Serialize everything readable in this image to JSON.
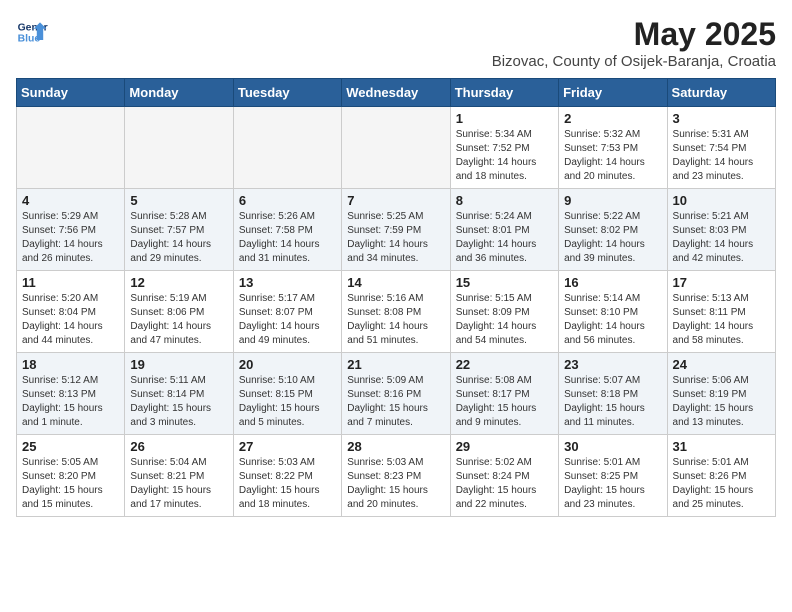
{
  "logo": {
    "line1": "General",
    "line2": "Blue"
  },
  "title": {
    "month_year": "May 2025",
    "location": "Bizovac, County of Osijek-Baranja, Croatia"
  },
  "weekdays": [
    "Sunday",
    "Monday",
    "Tuesday",
    "Wednesday",
    "Thursday",
    "Friday",
    "Saturday"
  ],
  "weeks": [
    [
      {
        "day": "",
        "info": ""
      },
      {
        "day": "",
        "info": ""
      },
      {
        "day": "",
        "info": ""
      },
      {
        "day": "",
        "info": ""
      },
      {
        "day": "1",
        "info": "Sunrise: 5:34 AM\nSunset: 7:52 PM\nDaylight: 14 hours\nand 18 minutes."
      },
      {
        "day": "2",
        "info": "Sunrise: 5:32 AM\nSunset: 7:53 PM\nDaylight: 14 hours\nand 20 minutes."
      },
      {
        "day": "3",
        "info": "Sunrise: 5:31 AM\nSunset: 7:54 PM\nDaylight: 14 hours\nand 23 minutes."
      }
    ],
    [
      {
        "day": "4",
        "info": "Sunrise: 5:29 AM\nSunset: 7:56 PM\nDaylight: 14 hours\nand 26 minutes."
      },
      {
        "day": "5",
        "info": "Sunrise: 5:28 AM\nSunset: 7:57 PM\nDaylight: 14 hours\nand 29 minutes."
      },
      {
        "day": "6",
        "info": "Sunrise: 5:26 AM\nSunset: 7:58 PM\nDaylight: 14 hours\nand 31 minutes."
      },
      {
        "day": "7",
        "info": "Sunrise: 5:25 AM\nSunset: 7:59 PM\nDaylight: 14 hours\nand 34 minutes."
      },
      {
        "day": "8",
        "info": "Sunrise: 5:24 AM\nSunset: 8:01 PM\nDaylight: 14 hours\nand 36 minutes."
      },
      {
        "day": "9",
        "info": "Sunrise: 5:22 AM\nSunset: 8:02 PM\nDaylight: 14 hours\nand 39 minutes."
      },
      {
        "day": "10",
        "info": "Sunrise: 5:21 AM\nSunset: 8:03 PM\nDaylight: 14 hours\nand 42 minutes."
      }
    ],
    [
      {
        "day": "11",
        "info": "Sunrise: 5:20 AM\nSunset: 8:04 PM\nDaylight: 14 hours\nand 44 minutes."
      },
      {
        "day": "12",
        "info": "Sunrise: 5:19 AM\nSunset: 8:06 PM\nDaylight: 14 hours\nand 47 minutes."
      },
      {
        "day": "13",
        "info": "Sunrise: 5:17 AM\nSunset: 8:07 PM\nDaylight: 14 hours\nand 49 minutes."
      },
      {
        "day": "14",
        "info": "Sunrise: 5:16 AM\nSunset: 8:08 PM\nDaylight: 14 hours\nand 51 minutes."
      },
      {
        "day": "15",
        "info": "Sunrise: 5:15 AM\nSunset: 8:09 PM\nDaylight: 14 hours\nand 54 minutes."
      },
      {
        "day": "16",
        "info": "Sunrise: 5:14 AM\nSunset: 8:10 PM\nDaylight: 14 hours\nand 56 minutes."
      },
      {
        "day": "17",
        "info": "Sunrise: 5:13 AM\nSunset: 8:11 PM\nDaylight: 14 hours\nand 58 minutes."
      }
    ],
    [
      {
        "day": "18",
        "info": "Sunrise: 5:12 AM\nSunset: 8:13 PM\nDaylight: 15 hours\nand 1 minute."
      },
      {
        "day": "19",
        "info": "Sunrise: 5:11 AM\nSunset: 8:14 PM\nDaylight: 15 hours\nand 3 minutes."
      },
      {
        "day": "20",
        "info": "Sunrise: 5:10 AM\nSunset: 8:15 PM\nDaylight: 15 hours\nand 5 minutes."
      },
      {
        "day": "21",
        "info": "Sunrise: 5:09 AM\nSunset: 8:16 PM\nDaylight: 15 hours\nand 7 minutes."
      },
      {
        "day": "22",
        "info": "Sunrise: 5:08 AM\nSunset: 8:17 PM\nDaylight: 15 hours\nand 9 minutes."
      },
      {
        "day": "23",
        "info": "Sunrise: 5:07 AM\nSunset: 8:18 PM\nDaylight: 15 hours\nand 11 minutes."
      },
      {
        "day": "24",
        "info": "Sunrise: 5:06 AM\nSunset: 8:19 PM\nDaylight: 15 hours\nand 13 minutes."
      }
    ],
    [
      {
        "day": "25",
        "info": "Sunrise: 5:05 AM\nSunset: 8:20 PM\nDaylight: 15 hours\nand 15 minutes."
      },
      {
        "day": "26",
        "info": "Sunrise: 5:04 AM\nSunset: 8:21 PM\nDaylight: 15 hours\nand 17 minutes."
      },
      {
        "day": "27",
        "info": "Sunrise: 5:03 AM\nSunset: 8:22 PM\nDaylight: 15 hours\nand 18 minutes."
      },
      {
        "day": "28",
        "info": "Sunrise: 5:03 AM\nSunset: 8:23 PM\nDaylight: 15 hours\nand 20 minutes."
      },
      {
        "day": "29",
        "info": "Sunrise: 5:02 AM\nSunset: 8:24 PM\nDaylight: 15 hours\nand 22 minutes."
      },
      {
        "day": "30",
        "info": "Sunrise: 5:01 AM\nSunset: 8:25 PM\nDaylight: 15 hours\nand 23 minutes."
      },
      {
        "day": "31",
        "info": "Sunrise: 5:01 AM\nSunset: 8:26 PM\nDaylight: 15 hours\nand 25 minutes."
      }
    ]
  ]
}
